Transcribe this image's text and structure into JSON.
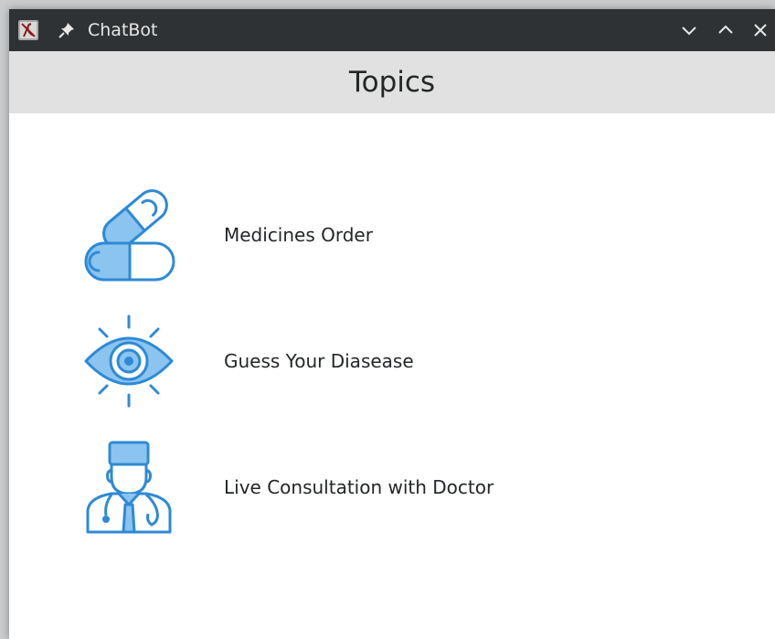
{
  "window": {
    "title": "ChatBot"
  },
  "header": {
    "title": "Topics"
  },
  "topics": [
    {
      "label": "Medicines Order",
      "icon": "pill-capsule-icon"
    },
    {
      "label": "Guess Your Diasease",
      "icon": "eye-icon"
    },
    {
      "label": "Live Consultation with Doctor",
      "icon": "doctor-icon"
    }
  ],
  "colors": {
    "titlebar": "#2f3234",
    "header_bg": "#e1e1e1",
    "icon_stroke": "#2d8ad6",
    "icon_fill": "#8cc4f0",
    "text": "#232627"
  }
}
